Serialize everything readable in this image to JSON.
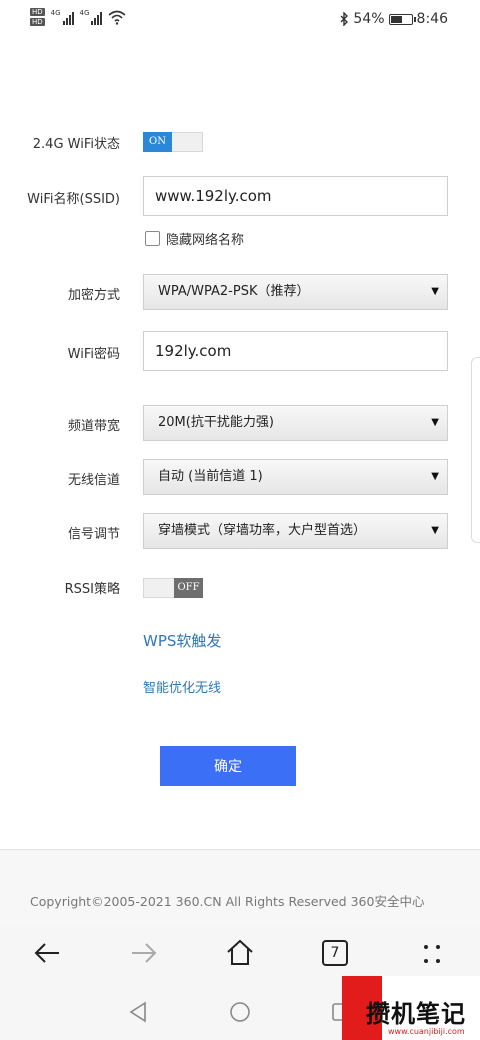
{
  "status_bar": {
    "hd_badge": "HD",
    "sim1_net": "4G",
    "sim2_net": "4G",
    "battery_text": "54%",
    "battery_level": 0.54,
    "time": "8:46"
  },
  "form": {
    "wifi_status": {
      "label": "2.4G WiFi状态",
      "toggle": "ON"
    },
    "ssid": {
      "label": "WiFi名称(SSID)",
      "value": "www.192ly.com"
    },
    "hide_ssid": {
      "label": "隐藏网络名称",
      "checked": false
    },
    "encryption": {
      "label": "加密方式",
      "selected": "WPA/WPA2-PSK（推荐）"
    },
    "password": {
      "label": "WiFi密码",
      "value": "192ly.com"
    },
    "bandwidth": {
      "label": "频道带宽",
      "selected": "20M(抗干扰能力强)"
    },
    "channel": {
      "label": "无线信道",
      "selected": "自动 (当前信道 1)"
    },
    "signal": {
      "label": "信号调节",
      "selected": "穿墙模式（穿墙功率，大户型首选）"
    },
    "rssi": {
      "label": "RSSI策略",
      "toggle": "OFF"
    }
  },
  "links": {
    "wps": "WPS软触发",
    "optimize": "智能优化无线"
  },
  "confirm_button": "确定",
  "footer": {
    "copyright": "Copyright©2005-2021 360.CN All Rights Reserved 360安全中心"
  },
  "browser_bar": {
    "tab_count": "7"
  },
  "watermark": {
    "text": "攒机笔记",
    "url": "www.cuanjibiji.com"
  },
  "colors": {
    "accent": "#2b88d8",
    "button": "#3b6ff5",
    "link": "#2f78b7"
  }
}
